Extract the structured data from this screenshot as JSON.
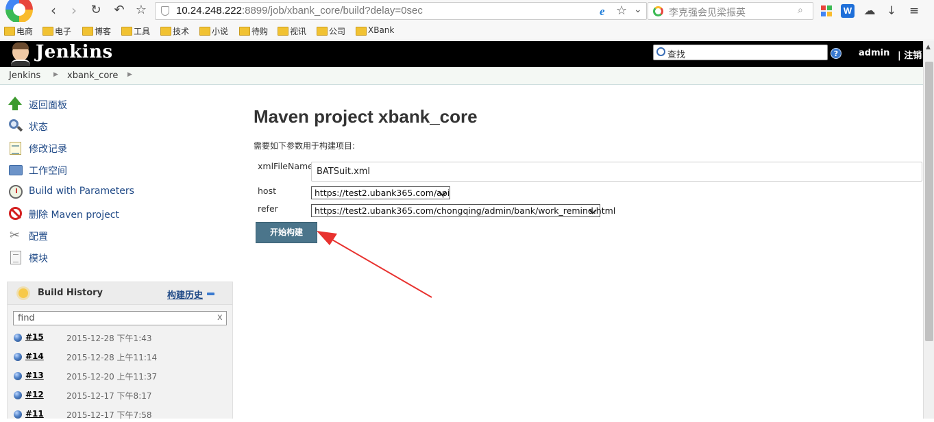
{
  "browser": {
    "url_host": "10.24.248.222",
    "url_rest": ":8899/job/xbank_core/build?delay=0sec",
    "search_placeholder": "李克强会见梁振英",
    "w_label": "W",
    "bookmarks": [
      "电商",
      "电子",
      "博客",
      "工具",
      "技术",
      "小说",
      "待购",
      "视讯",
      "公司",
      "XBank"
    ]
  },
  "header": {
    "title": "Jenkins",
    "search_placeholder": "查找",
    "help_label": "?",
    "user": "admin",
    "logout": "| 注销"
  },
  "breadcrumb": [
    "Jenkins",
    "xbank_core"
  ],
  "sidebar": {
    "tasks": [
      {
        "label": "返回面板",
        "icon": "up-arrow-icon"
      },
      {
        "label": "状态",
        "icon": "magnifier-icon"
      },
      {
        "label": "修改记录",
        "icon": "notepad-icon"
      },
      {
        "label": "工作空间",
        "icon": "folder-icon"
      },
      {
        "label": "Build with Parameters",
        "icon": "clock-icon"
      },
      {
        "label": "删除 Maven project",
        "icon": "no-entry-icon"
      },
      {
        "label": "配置",
        "icon": "tools-icon"
      },
      {
        "label": "模块",
        "icon": "document-icon"
      }
    ]
  },
  "build_history": {
    "title": "Build History",
    "trend_label": "构建历史",
    "filter_placeholder": "find",
    "filter_clear": "x",
    "builds": [
      {
        "number": "#15",
        "date": "2015-12-28 下午1:43"
      },
      {
        "number": "#14",
        "date": "2015-12-28 上午11:14"
      },
      {
        "number": "#13",
        "date": "2015-12-20 上午11:37"
      },
      {
        "number": "#12",
        "date": "2015-12-17 下午8:17"
      },
      {
        "number": "#11",
        "date": "2015-12-17 下午7:58"
      }
    ]
  },
  "main": {
    "title": "Maven project xbank_core",
    "description": "需要如下参数用于构建项目:",
    "params": [
      {
        "label": "xmlFileName",
        "value": "BATSuit.xml"
      },
      {
        "label": "host",
        "value": "https://test2.ubank365.com/api"
      },
      {
        "label": "refer",
        "value": "https://test2.ubank365.com/chongqing/admin/bank/work_remind.html"
      }
    ],
    "build_button": "开始构建"
  },
  "colors": {
    "header_bg": "#000000",
    "build_button": "#4b758b",
    "link": "#204a87",
    "annotation_arrow": "#e8322f"
  }
}
